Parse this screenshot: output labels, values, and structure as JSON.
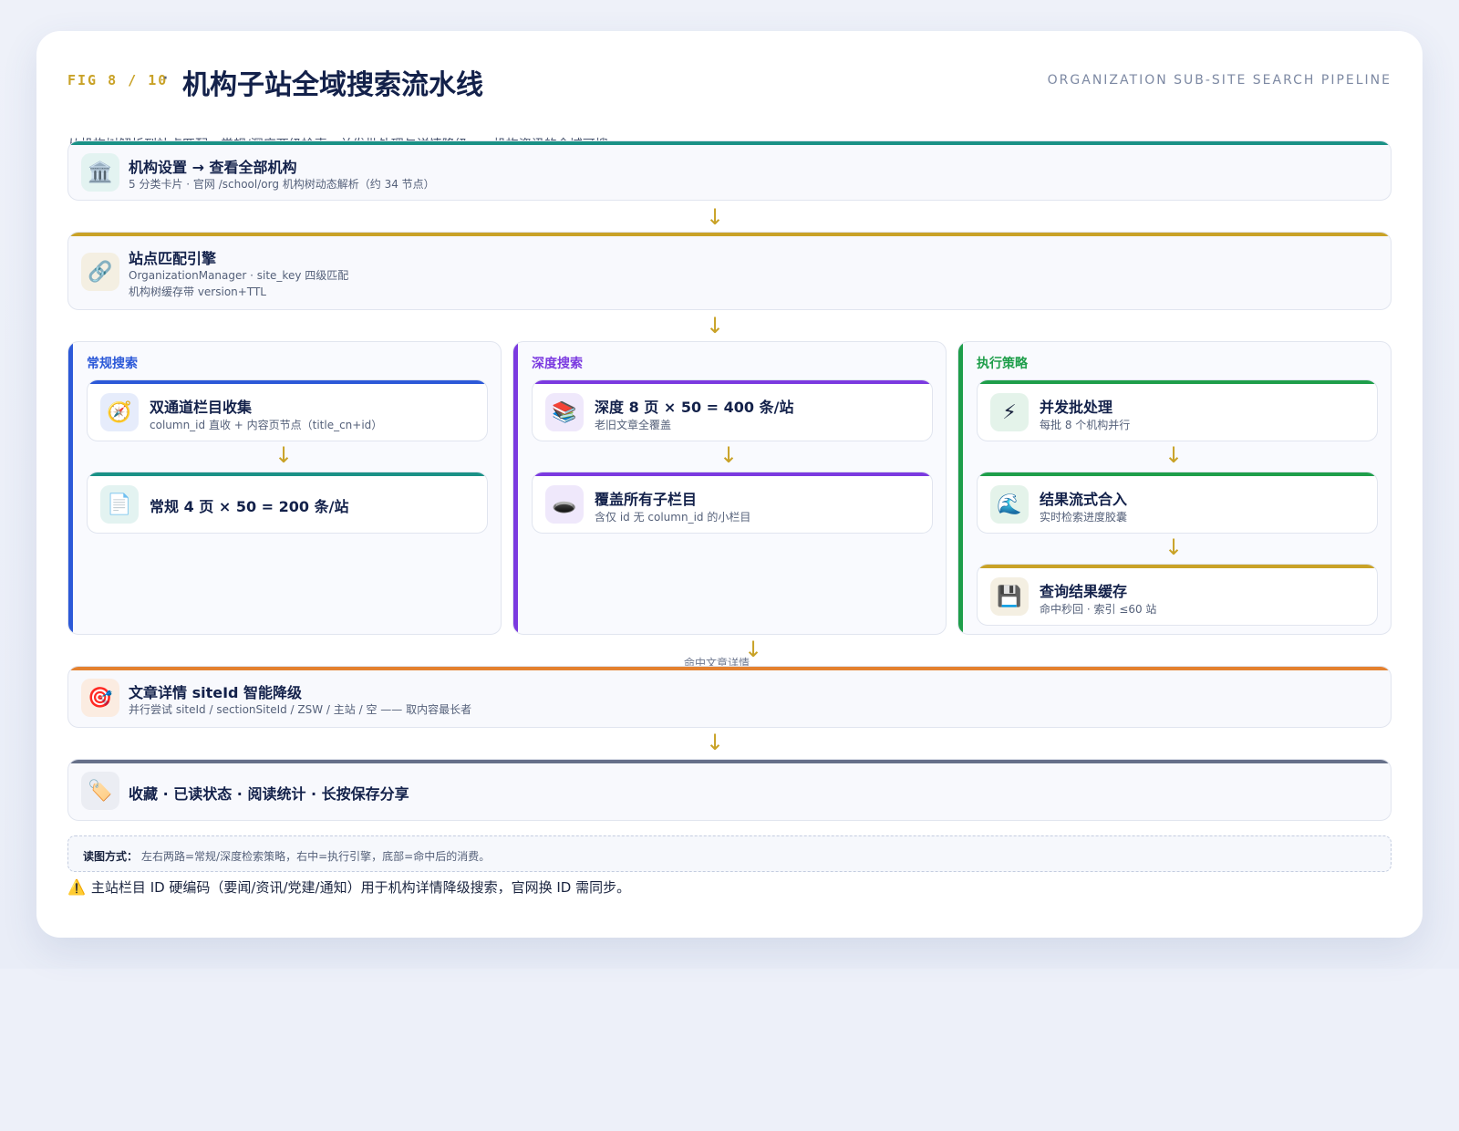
{
  "header": {
    "fig": "FIG 8 / 10",
    "dot": "·",
    "title": "机构子站全域搜索流水线",
    "en_title": "ORGANIZATION SUB-SITE SEARCH PIPELINE",
    "subtitle": "从机构树解析到站点匹配、常规/深度两级检索、并发批处理与详情降级——机构资讯的全域可搜。"
  },
  "colors": {
    "teal": "#1a9186",
    "gold": "#c9a227",
    "blue": "#2c59d8",
    "purple": "#7b3ae0",
    "green": "#1e9e4a",
    "orange": "#e4812f",
    "slate": "#667089"
  },
  "rows": {
    "org": {
      "icon": "🏛️",
      "icon_name": "institution-icon",
      "title": "机构设置 → 查看全部机构",
      "sub": "5 分类卡片 · 官网 /school/org 机构树动态解析（约 34 节点）"
    },
    "match": {
      "icon": "🔗",
      "icon_name": "link-icon",
      "title": "站点匹配引擎",
      "sub1": "OrganizationManager · site_key 四级匹配",
      "sub2": "机构树缓存带 version+TTL"
    },
    "detail": {
      "icon": "🎯",
      "icon_name": "target-icon",
      "title": "文章详情 siteId 智能降级",
      "sub": "并行尝试 siteId / sectionSiteId / ZSW / 主站 / 空 —— 取内容最长者"
    },
    "consume": {
      "icon": "🏷️",
      "icon_name": "tag-icon",
      "title": "收藏 · 已读状态 · 阅读统计 · 长按保存分享"
    }
  },
  "columns": {
    "normal": {
      "label": "常规搜索",
      "cards": [
        {
          "icon": "🧭",
          "title": "双通道栏目收集",
          "sub": "column_id 直收 + 内容页节点（title_cn+id）"
        },
        {
          "icon": "📄",
          "title": "常规 4 页 × 50 = 200 条/站",
          "sub": ""
        }
      ]
    },
    "deep": {
      "label": "深度搜索",
      "cards": [
        {
          "icon": "📚",
          "title": "深度 8 页 × 50 = 400 条/站",
          "sub": "老旧文章全覆盖"
        },
        {
          "icon": "🕳️",
          "title": "覆盖所有子栏目",
          "sub": "含仅 id 无 column_id 的小栏目"
        }
      ]
    },
    "exec": {
      "label": "执行策略",
      "cards": [
        {
          "icon": "⚡",
          "title": "并发批处理",
          "sub": "每批 8 个机构并行"
        },
        {
          "icon": "🌊",
          "title": "结果流式合入",
          "sub": "实时检索进度胶囊"
        },
        {
          "icon": "💾",
          "title": "查询结果缓存",
          "sub": "命中秒回 · 索引 ≤60 站"
        }
      ]
    }
  },
  "hit_label": "命中文章详情",
  "arrow": "↓",
  "note": {
    "key": "读图方式：",
    "value": "左右两路=常规/深度检索策略，右中=执行引擎，底部=命中后的消费。"
  },
  "warning": {
    "icon": "⚠️",
    "text": "主站栏目 ID 硬编码（要闻/资讯/党建/通知）用于机构详情降级搜索，官网换 ID 需同步。"
  }
}
